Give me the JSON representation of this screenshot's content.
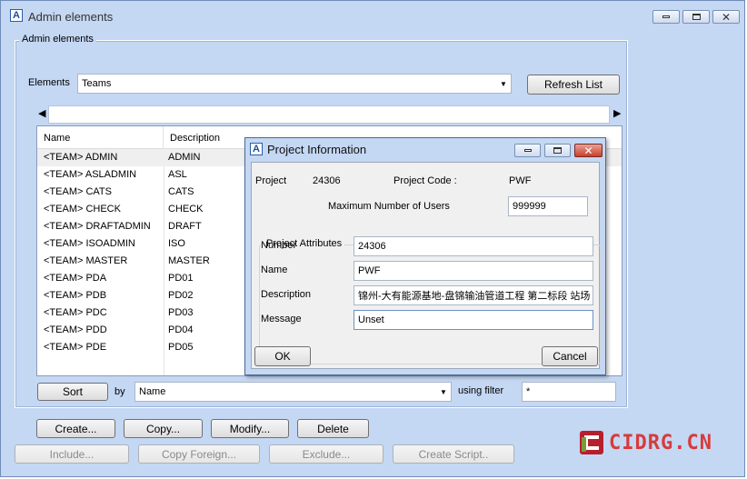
{
  "window": {
    "title": "Admin elements",
    "controls": {
      "minimize": "minimize",
      "maximize": "maximize",
      "close": "close"
    }
  },
  "group": {
    "title": "Admin elements"
  },
  "elements_row": {
    "label": "Elements",
    "value": "Teams",
    "refresh_label": "Refresh List"
  },
  "list": {
    "headers": [
      "Name",
      "Description"
    ],
    "rows": [
      [
        "<TEAM>  ADMIN",
        "ADMIN"
      ],
      [
        "<TEAM>  ASLADMIN",
        "ASL"
      ],
      [
        "<TEAM>  CATS",
        "CATS"
      ],
      [
        "<TEAM>  CHECK",
        "CHECK"
      ],
      [
        "<TEAM>  DRAFTADMIN",
        "DRAFT"
      ],
      [
        "<TEAM>  ISOADMIN",
        "ISO"
      ],
      [
        "<TEAM>  MASTER",
        "MASTER"
      ],
      [
        "<TEAM>  PDA",
        "PD01"
      ],
      [
        "<TEAM>  PDB",
        "PD02"
      ],
      [
        "<TEAM>  PDC",
        "PD03"
      ],
      [
        "<TEAM>  PDD",
        "PD04"
      ],
      [
        "<TEAM>  PDE",
        "PD05"
      ]
    ]
  },
  "sort_row": {
    "sort_label": "Sort",
    "by_label": "by",
    "by_value": "Name",
    "filter_label": "using filter",
    "filter_value": "*"
  },
  "actions": {
    "create": "Create...",
    "copy": "Copy...",
    "modify": "Modify...",
    "delete": "Delete"
  },
  "disabled_actions": {
    "include": "Include...",
    "copy_foreign": "Copy Foreign...",
    "exclude": "Exclude...",
    "create_script": "Create Script.."
  },
  "dialog": {
    "title": "Project Information",
    "project_label": "Project",
    "project_value": "24306",
    "project_code_label": "Project Code :",
    "project_code_value": "PWF",
    "max_users_label": "Maximum Number of Users",
    "max_users_value": "999999",
    "attributes_title": "Project Attributes",
    "number_label": "Number",
    "number_value": "24306",
    "name_label": "Name",
    "name_value": "PWF",
    "description_label": "Description",
    "description_value": "锦州-大有能源基地-盘锦输油管道工程 第二标段 站场",
    "message_label": "Message",
    "message_value": "Unset",
    "ok_label": "OK",
    "cancel_label": "Cancel"
  },
  "watermark": {
    "text": "CIDRG.CN",
    "color": "#d73b3b"
  }
}
